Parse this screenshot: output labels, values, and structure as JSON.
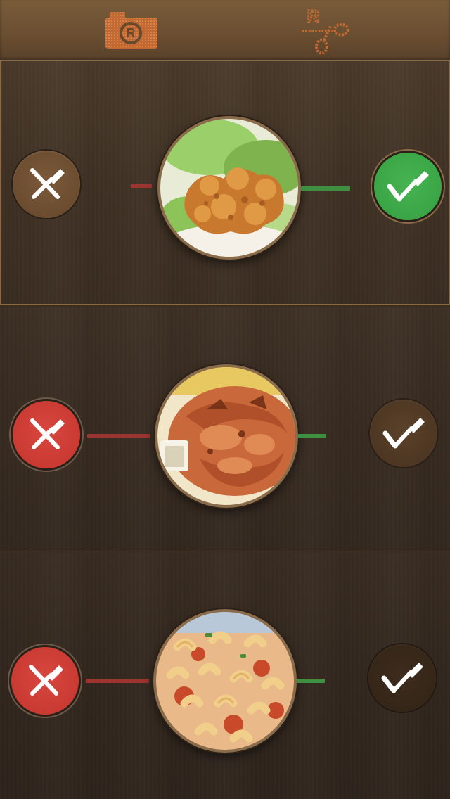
{
  "toolbar": {
    "left_icon": "camera-r-icon",
    "right_icon": "scissors-r-icon",
    "accent": "#c9703a"
  },
  "rows": [
    {
      "food_icon": "fried-chicken-photo",
      "dislike_icon": "crossed-fork-knife-icon",
      "like_icon": "check-fork-icon",
      "dislike_state": "inactive",
      "like_state": "selected",
      "dislike_color": "#6b4c2f",
      "like_color": "#3aa546"
    },
    {
      "food_icon": "roast-chicken-photo",
      "dislike_icon": "crossed-fork-knife-icon",
      "like_icon": "check-fork-icon",
      "dislike_state": "selected",
      "like_state": "inactive",
      "dislike_color": "#c93a33",
      "like_color": "#4d3722"
    },
    {
      "food_icon": "macaroni-pasta-photo",
      "dislike_icon": "crossed-fork-knife-icon",
      "like_icon": "check-fork-icon",
      "dislike_state": "selected",
      "like_state": "inactive",
      "dislike_color": "#c93a33",
      "like_color": "#352618"
    }
  ],
  "colors": {
    "toolbar_bg": "#6a4e31",
    "panel_bg": "#3a2d21",
    "red_line": "#9a3530",
    "green_line": "#3f8f43"
  }
}
